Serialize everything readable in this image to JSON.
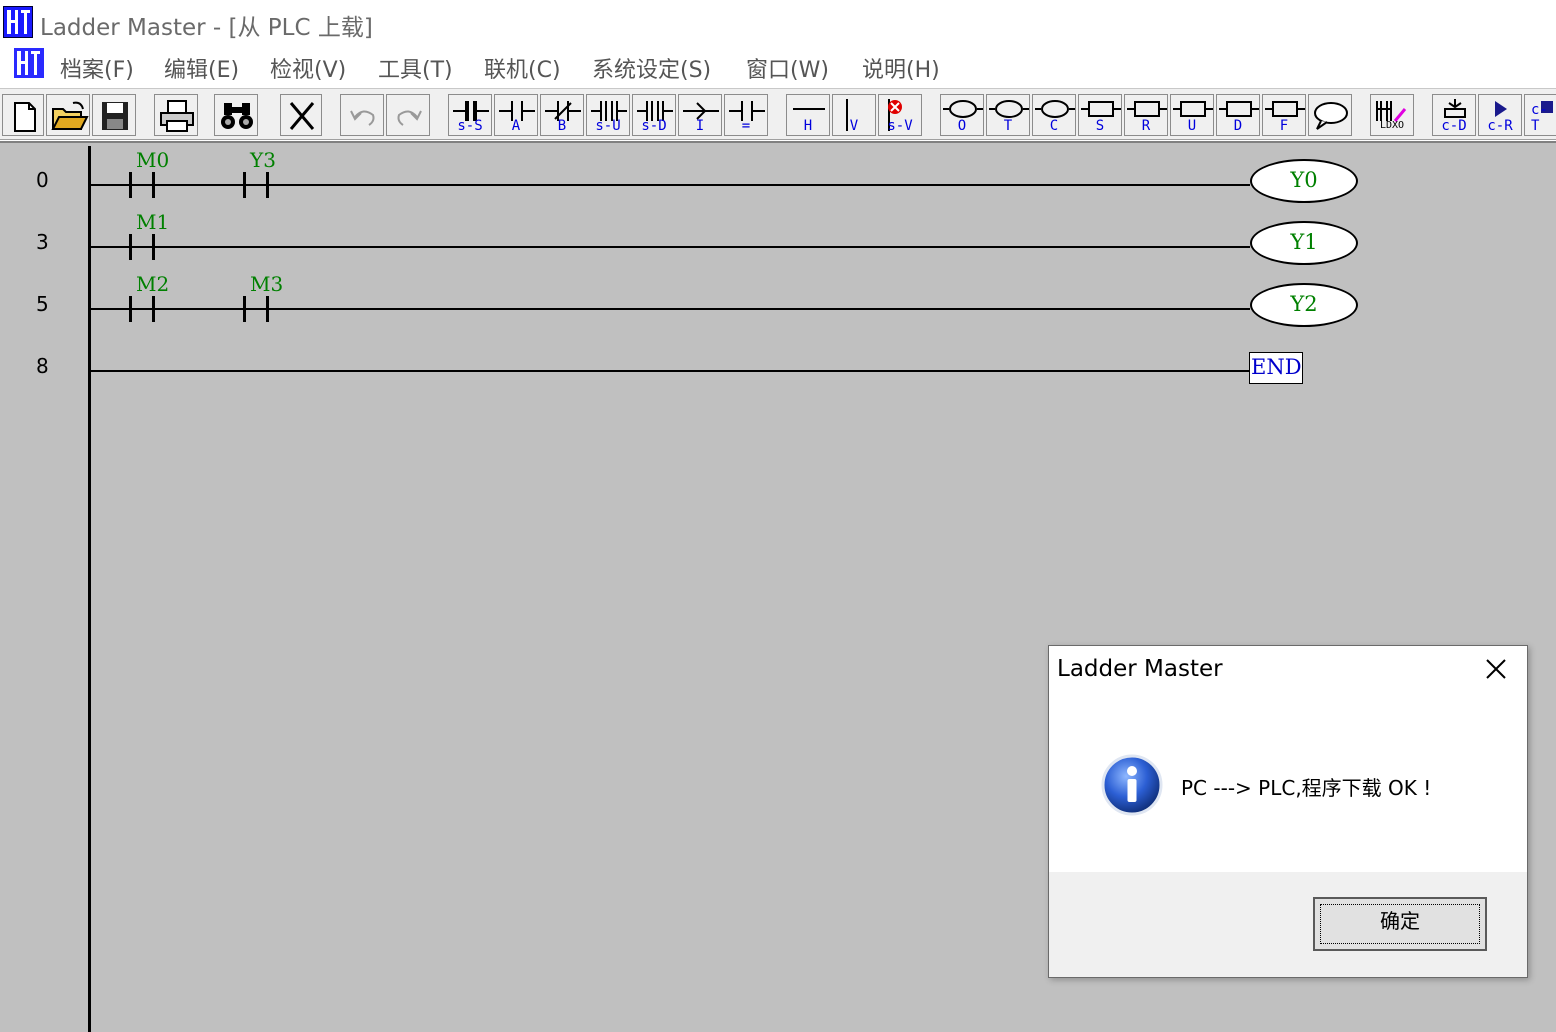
{
  "window": {
    "title": "Ladder Master - [从 PLC 上载]",
    "icon": "ladder-master-logo-icon"
  },
  "menu": {
    "items": [
      "档案(F)",
      "编辑(E)",
      "检视(V)",
      "工具(T)",
      "联机(C)",
      "系统设定(S)",
      "窗口(W)",
      "说明(H)"
    ]
  },
  "toolbar": {
    "buttons": [
      {
        "icon": "new-file-icon",
        "label": ""
      },
      {
        "icon": "open-folder-icon",
        "label": ""
      },
      {
        "icon": "save-icon",
        "label": ""
      },
      {
        "icon": "print-icon",
        "label": ""
      },
      {
        "icon": "find-binoculars-icon",
        "label": ""
      },
      {
        "icon": "delete-x-icon",
        "label": ""
      },
      {
        "icon": "undo-icon",
        "label": ""
      },
      {
        "icon": "redo-icon",
        "label": ""
      },
      {
        "icon": "contact-icon",
        "label": "s-S"
      },
      {
        "icon": "contact-icon",
        "label": "A"
      },
      {
        "icon": "contact-nc-icon",
        "label": "B"
      },
      {
        "icon": "contact-icon",
        "label": "s-U"
      },
      {
        "icon": "contact-icon",
        "label": "s-D"
      },
      {
        "icon": "inverse-icon",
        "label": "I"
      },
      {
        "icon": "compare-icon",
        "label": "="
      },
      {
        "icon": "horizontal-line-icon",
        "label": "H"
      },
      {
        "icon": "vertical-line-icon",
        "label": "V"
      },
      {
        "icon": "delete-vertical-icon",
        "label": "s-V"
      },
      {
        "icon": "coil-icon",
        "label": "O"
      },
      {
        "icon": "coil-icon",
        "label": "T"
      },
      {
        "icon": "coil-icon",
        "label": "C"
      },
      {
        "icon": "function-box-icon",
        "label": "S"
      },
      {
        "icon": "function-box-icon",
        "label": "R"
      },
      {
        "icon": "function-box-icon",
        "label": "U"
      },
      {
        "icon": "function-box-icon",
        "label": "D"
      },
      {
        "icon": "function-box-icon",
        "label": "F"
      },
      {
        "icon": "comment-bubble-icon",
        "label": ""
      },
      {
        "icon": "ldxo-icon",
        "label": "LDXO"
      },
      {
        "icon": "connect-icon",
        "label": "c-D"
      },
      {
        "icon": "run-icon",
        "label": "c-R"
      },
      {
        "icon": "stop-icon",
        "label": "c-T"
      }
    ]
  },
  "ladder": {
    "rungs": [
      {
        "step": "0",
        "contacts": [
          "M0",
          "Y3"
        ],
        "output": "Y0"
      },
      {
        "step": "3",
        "contacts": [
          "M1"
        ],
        "output": "Y1"
      },
      {
        "step": "5",
        "contacts": [
          "M2",
          "M3"
        ],
        "output": "Y2"
      },
      {
        "step": "8",
        "contacts": [],
        "output": "END"
      }
    ]
  },
  "dialog": {
    "title": "Ladder Master",
    "message": "PC ---> PLC,程序下载 OK !",
    "icon": "info-icon",
    "ok_label": "确定"
  },
  "colors": {
    "editor_bg": "#c0c0c0",
    "device_label": "#008000",
    "end_label": "#0000cc",
    "toolbar_label": "#0000dd"
  }
}
